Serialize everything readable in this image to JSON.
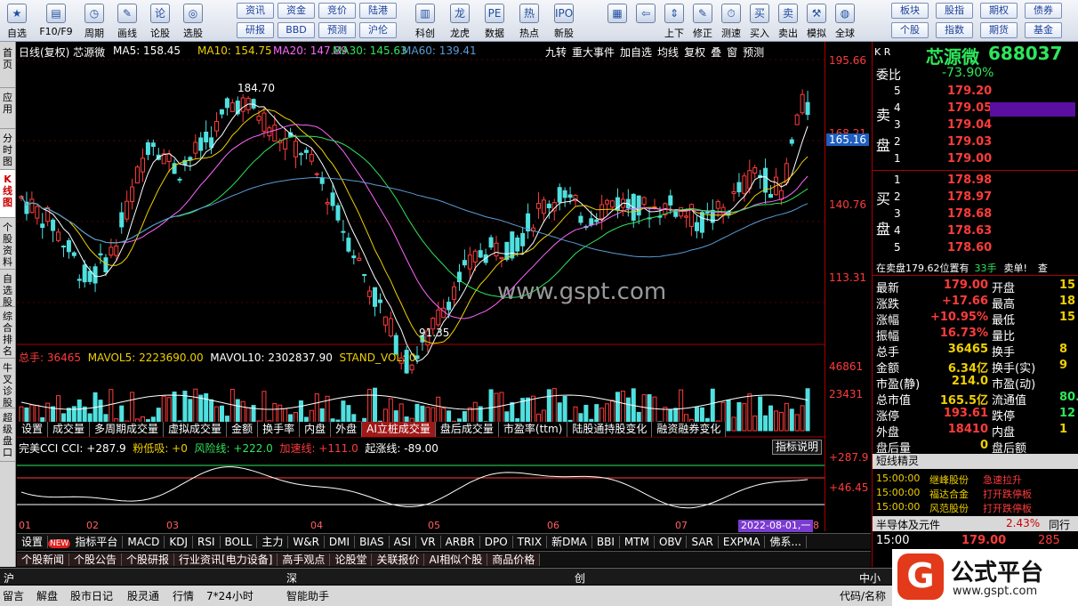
{
  "toolbar": {
    "items": [
      {
        "label": "自选",
        "icon": "star-icon",
        "glyph": "★"
      },
      {
        "label": "F10/F9",
        "icon": "f10-icon",
        "glyph": "▤"
      },
      {
        "label": "周期",
        "icon": "clock-icon",
        "glyph": "◷"
      },
      {
        "label": "画线",
        "icon": "pencil-icon",
        "glyph": "✎"
      },
      {
        "label": "论股",
        "icon": "discuss-icon",
        "glyph": "论"
      },
      {
        "label": "选股",
        "icon": "select-stock-icon",
        "glyph": "◎"
      }
    ],
    "buttons_row1": [
      "资讯",
      "资金",
      "竞价",
      "陆港"
    ],
    "buttons_row2": [
      "研报",
      "BBD",
      "预测",
      "沪伦"
    ],
    "items2": [
      {
        "label": "科创",
        "icon": "chart-icon",
        "glyph": "▥"
      },
      {
        "label": "龙虎",
        "icon": "dragon-icon",
        "glyph": "龙"
      },
      {
        "label": "数据",
        "icon": "pe-icon",
        "glyph": "PE"
      },
      {
        "label": "热点",
        "icon": "hot-icon",
        "glyph": "热"
      },
      {
        "label": "新股",
        "icon": "ipo-icon",
        "glyph": "IPO"
      }
    ],
    "items3": [
      {
        "label": "",
        "icon": "windows-icon",
        "glyph": "▦"
      },
      {
        "label": "",
        "icon": "back-arrow-icon",
        "glyph": "⇦"
      },
      {
        "label": "上下",
        "icon": "updown-icon",
        "glyph": "⇕"
      },
      {
        "label": "修正",
        "icon": "fix-icon",
        "glyph": "✎"
      },
      {
        "label": "测速",
        "icon": "speed-icon",
        "glyph": "⏱"
      },
      {
        "label": "买入",
        "icon": "buy-icon",
        "glyph": "买"
      },
      {
        "label": "卖出",
        "icon": "sell-icon",
        "glyph": "卖"
      },
      {
        "label": "模拟",
        "icon": "hammer-icon",
        "glyph": "⚒"
      },
      {
        "label": "全球",
        "icon": "globe-icon",
        "glyph": "◍"
      }
    ],
    "right_row1": [
      "板块",
      "股指",
      "期权",
      "债券"
    ],
    "right_row2": [
      "个股",
      "指数",
      "期货",
      "基金"
    ]
  },
  "leftnav": [
    "首页",
    "应用",
    "分时图",
    "K线图",
    "个股资料",
    "自选股",
    "综合排名",
    "牛叉诊股",
    "超级盘口"
  ],
  "header": {
    "title": "日线(复权) 芯源微",
    "ma5": "MA5: 158.45",
    "ma10": "MA10: 154.75",
    "ma20": "MA20: 147.89",
    "ma30": "MA30: 145.63",
    "ma60": "MA60: 139.41",
    "menu": [
      "九转",
      "重大事件",
      "加自选",
      "均线",
      "复权",
      "叠",
      "窗",
      "预测"
    ]
  },
  "price_axis": [
    "195.66",
    "168.21",
    "140.76",
    "113.31"
  ],
  "price_tag": "165.16",
  "price_annot": {
    "high": "184.70",
    "low": "91.35"
  },
  "watermark": "www.gspt.com",
  "vol": {
    "label": "总手: 36465",
    "mavol5": "MAVOL5: 2223690.00",
    "mavol10": "MAVOL10: 2302837.90",
    "stand": "STAND_VOL: 0",
    "axis": [
      "46861",
      "23431"
    ]
  },
  "ind_tabs": [
    "设置",
    "成交量",
    "多周期成交量",
    "虚拟成交量",
    "金额",
    "换手率",
    "内盘",
    "外盘",
    "AI立桩成交量",
    "盘后成交量",
    "市盈率(ttm)",
    "陆股通持股变化",
    "融资融券变化"
  ],
  "cci": {
    "label": "完美CCI CCI: +287.9",
    "a": "粉低吸: +0",
    "b": "风险线: +222.0",
    "c": "加速线: +111.0",
    "d": "起涨线: -89.00",
    "btn": "指标说明",
    "axis": [
      "+287.9",
      "+46.45"
    ]
  },
  "months": [
    "01",
    "02",
    "03",
    "04",
    "05",
    "06",
    "07",
    "08"
  ],
  "date_tag": "2022-08-01,一",
  "bottom_tabs": [
    "设置",
    "指标平台",
    "MACD",
    "KDJ",
    "RSI",
    "BOLL",
    "主力",
    "W&R",
    "DMI",
    "BIAS",
    "ASI",
    "VR",
    "ARBR",
    "DPO",
    "TRIX",
    "新DMA",
    "BBI",
    "MTM",
    "OBV",
    "SAR",
    "EXPMA",
    "佛系..."
  ],
  "new_badge": "NEW",
  "news_tabs": [
    "个股新闻",
    "个股公告",
    "个股研报",
    "行业资讯[电力设备]",
    "高手观点",
    "论股堂",
    "关联报价",
    "AI相似个股",
    "商品价格"
  ],
  "status1": [
    "沪",
    "深",
    "创",
    "中小"
  ],
  "status2": [
    "留言",
    "解盘",
    "股市日记",
    "股灵通",
    "行情",
    "7*24小时",
    "智能助手"
  ],
  "status_right": "代码/名称",
  "right": {
    "name": "芯源微",
    "code": "688037",
    "kr": "K R",
    "weibi_label": "委比",
    "weibi": "-73.90%",
    "sell_side": "卖盘",
    "buy_side": "买盘",
    "sells": [
      [
        "5",
        "179.20"
      ],
      [
        "4",
        "179.05"
      ],
      [
        "3",
        "179.04"
      ],
      [
        "2",
        "179.03"
      ],
      [
        "1",
        "179.00"
      ]
    ],
    "buys": [
      [
        "1",
        "178.98"
      ],
      [
        "2",
        "178.97"
      ],
      [
        "3",
        "178.68"
      ],
      [
        "4",
        "178.63"
      ],
      [
        "5",
        "178.60"
      ]
    ],
    "notice_a": "在卖盘179.62位置有",
    "notice_b": "33手",
    "notice_c": "卖单!",
    "notice_d": "查",
    "quotes": [
      [
        "最新",
        "179.00",
        "开盘",
        "15"
      ],
      [
        "涨跌",
        "+17.66",
        "最高",
        "18"
      ],
      [
        "涨幅",
        "+10.95%",
        "最低",
        "15"
      ],
      [
        "振幅",
        "16.73%",
        "量比",
        ""
      ],
      [
        "总手",
        "36465",
        "换手",
        "8"
      ],
      [
        "金额",
        "6.34亿",
        "换手(实)",
        "9"
      ],
      [
        "市盈(静)",
        "214.0",
        "市盈(动)",
        ""
      ],
      [
        "总市值",
        "165.5亿",
        "流通值",
        "80."
      ],
      [
        "涨停",
        "193.61",
        "跌停",
        "12"
      ],
      [
        "外盘",
        "18410",
        "内盘",
        "1"
      ],
      [
        "盘后量",
        "0",
        "盘后额",
        ""
      ]
    ],
    "elves_title": "短线精灵",
    "elves": [
      [
        "15:00:00",
        "继峰股份",
        "急速拉升"
      ],
      [
        "15:00:00",
        "福达合金",
        "打开跌停板"
      ],
      [
        "15:00:00",
        "风范股份",
        "打开跌停板"
      ]
    ],
    "sector": "半导体及元件",
    "sector_pct": "2.43%",
    "sector_extra": "同行业",
    "last_time": "15:00",
    "last_price": "179.00",
    "last_vol": "285"
  },
  "brand": {
    "name": "公式平台",
    "url": "www.gspt.com"
  },
  "colors": {
    "up": "#ff3b3b",
    "down": "#50e0e0",
    "bg": "#000000",
    "ma5": "#ffffff",
    "ma10": "#f0d000",
    "ma20": "#ff66ff",
    "ma30": "#2ee65a",
    "ma60": "#5a9bd5"
  }
}
